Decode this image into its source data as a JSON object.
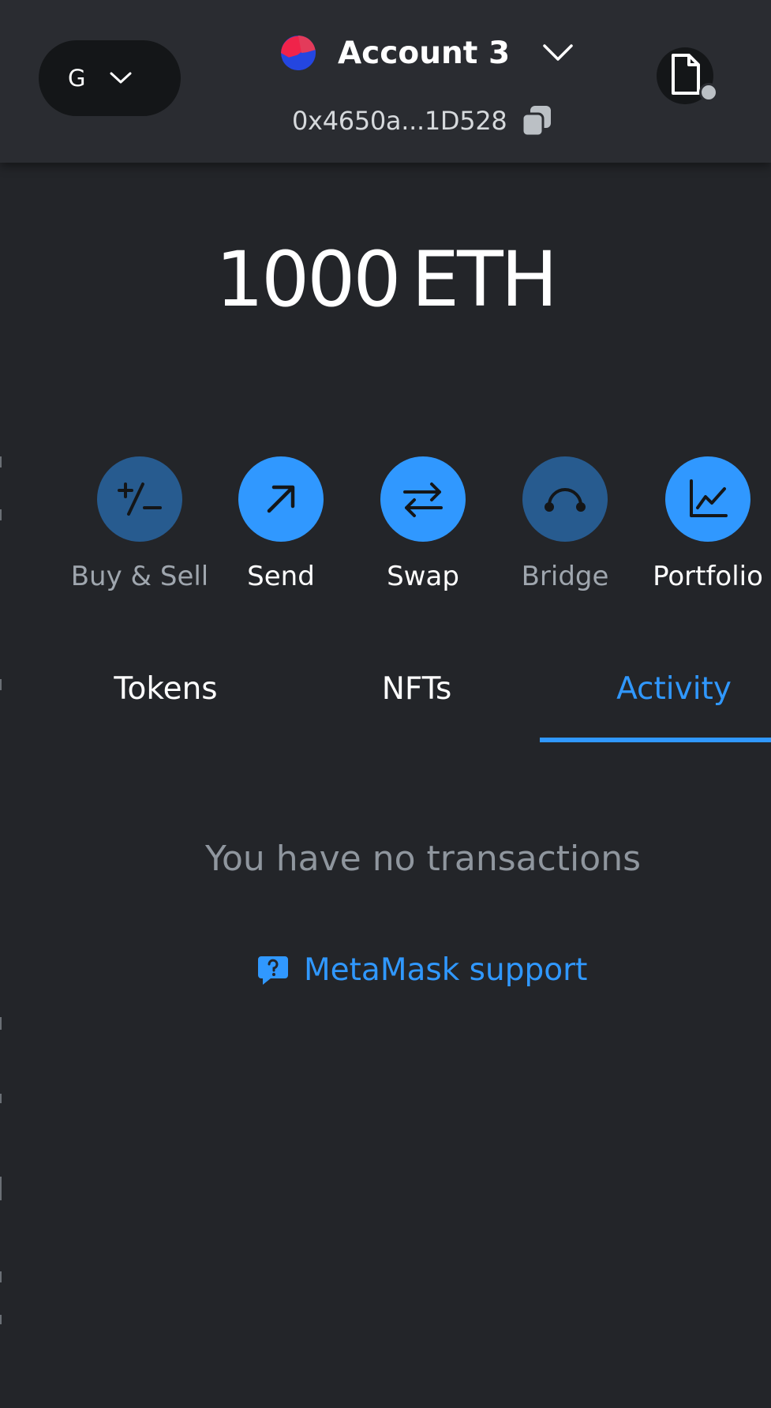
{
  "header": {
    "network": {
      "letter": "G",
      "chevron_icon": "chevron-down-icon"
    },
    "account": {
      "name": "Account 3",
      "avatar_icon": "account-avatar-icon",
      "chevron_icon": "chevron-down-icon"
    },
    "address": {
      "text": "0x4650a...1D528",
      "copy_icon": "copy-icon"
    },
    "connection": {
      "icon": "file-connection-icon",
      "status_color": "#bbc0c5"
    }
  },
  "balance": {
    "amount": "1000",
    "unit": "ETH"
  },
  "actions": [
    {
      "label": "Buy & Sell",
      "icon": "plus-minus-icon",
      "enabled": false
    },
    {
      "label": "Send",
      "icon": "arrow-up-right-icon",
      "enabled": true
    },
    {
      "label": "Swap",
      "icon": "swap-arrows-icon",
      "enabled": true
    },
    {
      "label": "Bridge",
      "icon": "bridge-icon",
      "enabled": false
    },
    {
      "label": "Portfolio",
      "icon": "chart-line-icon",
      "enabled": true
    }
  ],
  "tabs": [
    {
      "label": "Tokens",
      "selected": false
    },
    {
      "label": "NFTs",
      "selected": false
    },
    {
      "label": "Activity",
      "selected": true
    }
  ],
  "activity": {
    "empty_message": "You have no transactions",
    "support_link": "MetaMask support",
    "support_icon": "question-chat-icon"
  },
  "colors": {
    "background": "#232529",
    "header_background": "#2a2c31",
    "accent": "#3098ff",
    "accent_muted": "#275b8f",
    "muted_text": "#8f969e"
  }
}
